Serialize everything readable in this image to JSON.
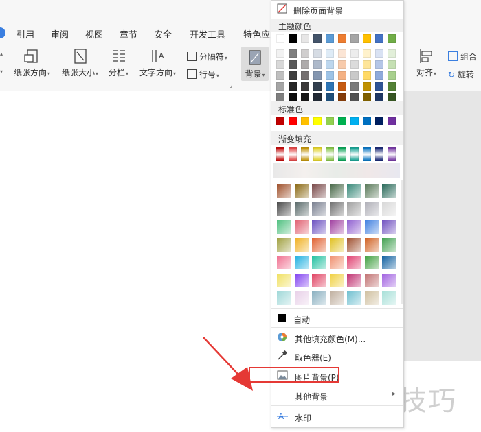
{
  "ribbon": {
    "tabs": [
      "引用",
      "审阅",
      "视图",
      "章节",
      "安全",
      "开发工具",
      "特色应用"
    ],
    "tools": {
      "orientation": "纸张方向",
      "size": "纸张大小",
      "columns": "分栏",
      "text_direction": "文字方向",
      "breaks": "分隔符",
      "line_number": "行号",
      "background": "背景",
      "align": "对齐",
      "group": "组合",
      "rotate": "旋转"
    }
  },
  "menu": {
    "remove_background": "删除页面背景",
    "theme_colors_header": "主题颜色",
    "standard_colors_header": "标准色",
    "gradient_header": "渐变填充",
    "auto": "自动",
    "more_fill": "其他填充颜色(M)...",
    "eyedropper": "取色器(E)",
    "picture_background": "图片背景(P)",
    "other_background": "其他背景",
    "watermark": "水印",
    "theme_top_row": [
      "#ffffff",
      "#000000",
      "#e7e6e6",
      "#44546a",
      "#5b9bd5",
      "#ed7d31",
      "#a5a5a5",
      "#ffc000",
      "#4472c4",
      "#70ad47"
    ],
    "theme_shades": [
      [
        "#f2f2f2",
        "#7f7f7f",
        "#d0cece",
        "#d6dce4",
        "#deebf6",
        "#fbe5d5",
        "#ededed",
        "#fff2cc",
        "#d9e2f3",
        "#e2efd9"
      ],
      [
        "#d8d8d8",
        "#595959",
        "#aeabab",
        "#adb9ca",
        "#bdd7ee",
        "#f7cbac",
        "#dbdbdb",
        "#fee599",
        "#b4c6e7",
        "#c5e0b3"
      ],
      [
        "#bfbfbf",
        "#3f3f3f",
        "#757070",
        "#8496b0",
        "#9dc3e6",
        "#f4b183",
        "#c9c9c9",
        "#ffd965",
        "#8eaadb",
        "#a8d08d"
      ],
      [
        "#a5a5a5",
        "#262626",
        "#3a3838",
        "#323f4f",
        "#2e75b5",
        "#c55a11",
        "#7b7b7b",
        "#bf9000",
        "#2f5496",
        "#538135"
      ],
      [
        "#7f7f7f",
        "#0c0c0c",
        "#171616",
        "#222a35",
        "#1e4e79",
        "#833c0b",
        "#525252",
        "#7f6000",
        "#1f3864",
        "#375623"
      ]
    ],
    "standard_colors": [
      "#c00000",
      "#ff0000",
      "#ffc000",
      "#ffff00",
      "#92d050",
      "#00b050",
      "#00b0f0",
      "#0070c0",
      "#002060",
      "#7030a0"
    ],
    "gradient_row": [
      "#c00000",
      "#e04040",
      "#c09000",
      "#e0d020",
      "#80c040",
      "#00a050",
      "#10a090",
      "#0070c0",
      "#102070",
      "#7030a0"
    ],
    "gradient_grid": [
      [
        "#a0522d",
        "#8b6914",
        "#7a4a4a",
        "#4a6a4a",
        "#3a8a7a",
        "#5a7a5a",
        "#2a6a5a"
      ],
      [
        "#4a4a4a",
        "#5a6a6a",
        "#7a8090",
        "#707070",
        "#a0a0a0",
        "#b0b0b8",
        "#d8d8d8"
      ],
      [
        "#50c080",
        "#e06070",
        "#6a50c0",
        "#a040a0",
        "#9060d0",
        "#4080e0",
        "#7050c0"
      ],
      [
        "#a0a040",
        "#f0b020",
        "#e06030",
        "#e0c020",
        "#a05030",
        "#d06020",
        "#40a050"
      ],
      [
        "#f07090",
        "#20b0e0",
        "#20c0a0",
        "#f09070",
        "#e04070",
        "#40a040",
        "#1060a0"
      ],
      [
        "#f0e060",
        "#8040f0",
        "#e04060",
        "#f0d040",
        "#c03070",
        "#c07070",
        "#a060e0"
      ],
      [
        "#a0d8d8",
        "#e8d0e8",
        "#8ab0c0",
        "#c0b0a0",
        "#70c0d0",
        "#d0c0a0",
        "#a8e0d8"
      ]
    ]
  },
  "watermark_text": "软件技巧",
  "colors": {
    "accent_red": "#e53935",
    "app_blue": "#3b7fe0"
  }
}
